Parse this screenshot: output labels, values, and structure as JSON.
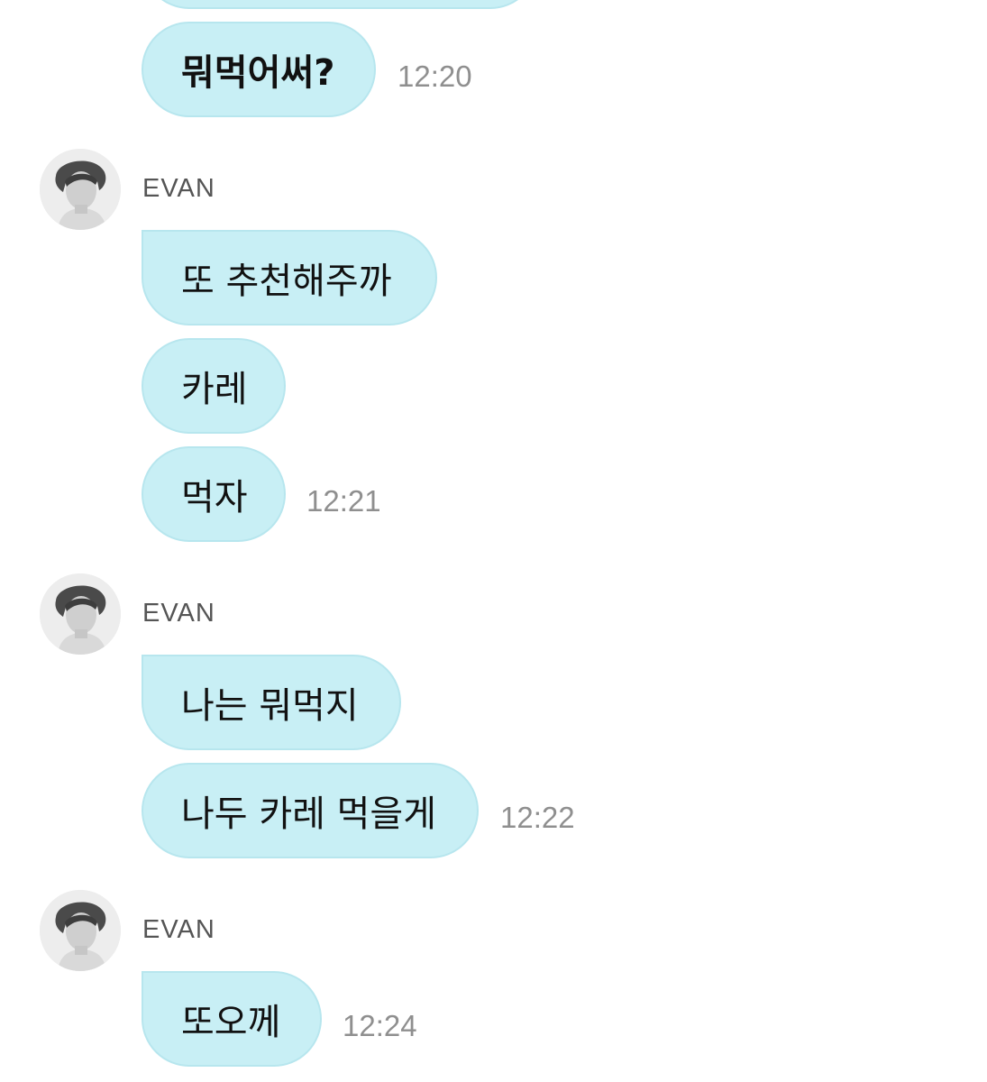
{
  "messages": [
    {
      "text": "",
      "time": ""
    },
    {
      "text": "뭐먹어써?",
      "time": "12:20"
    }
  ],
  "groups": [
    {
      "sender": "EVAN",
      "messages": [
        {
          "text": "또 추천해주까",
          "time": ""
        },
        {
          "text": "카레",
          "time": ""
        },
        {
          "text": "먹자",
          "time": "12:21"
        }
      ]
    },
    {
      "sender": "EVAN",
      "messages": [
        {
          "text": "나는 뭐먹지",
          "time": ""
        },
        {
          "text": "나두 카레 먹을게",
          "time": "12:22"
        }
      ]
    },
    {
      "sender": "EVAN",
      "messages": [
        {
          "text": "또오께",
          "time": "12:24"
        }
      ]
    }
  ],
  "colors": {
    "bubble": "#c8eff5",
    "bubble_border": "#b7e6ee",
    "timestamp": "#8f8f8f",
    "sender": "#555555"
  },
  "icons": {
    "avatar": "profile-photo-avatar"
  }
}
